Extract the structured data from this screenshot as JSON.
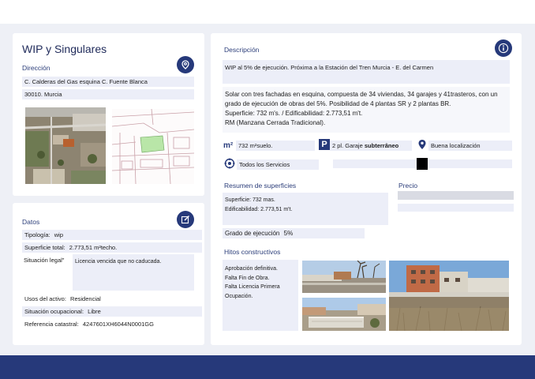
{
  "colors": {
    "accent": "#26397a",
    "panel_bg": "#ffffff",
    "field_bg": "#eceef8",
    "page_bg": "#eef0f6"
  },
  "header": {
    "title": "WIP y Singulares"
  },
  "direccion": {
    "label": "Dirección",
    "icon": "location-pin-icon",
    "line1": "C. Calderas del Gas esquina C. Fuente Blanca",
    "line2": "30010. Murcia"
  },
  "datos": {
    "label": "Datos",
    "icon": "edit-icon",
    "tipologia_label": "Tipología:",
    "tipologia_value": "wip",
    "superficie_label": "Superficie total:",
    "superficie_value": "2.773,51 m²techo.",
    "situacion_label": "Situación legal\"",
    "situacion_value": "Licencia vencida que no caducada.",
    "usos_label": "Usos del activo:",
    "usos_value": "Residencial",
    "ocupacional_label": "Situación ocupacional:",
    "ocupacional_value": "Libre",
    "catastral_label": "Referencia catastral:",
    "catastral_value": "4247601XH6044N0001GG"
  },
  "descripcion": {
    "label": "Descripción",
    "icon": "info-icon",
    "short": "WIP al 5% de ejecución. Próxima a la Estación del Tren Murcia - E. del Carmen",
    "long1": "Solar con tres fachadas en esquina, compuesta de 34 viviendas, 34 garajes y 41trasteros, con un grado de ejecución de obras del 5%. Posibilidad de 4 plantas SR y 2 plantas BR.",
    "long2": "Superficie: 732 m's. / Edificabilidad: 2.773,51 m't.",
    "long3": "RM (Manzana Cerrada Tradicional)."
  },
  "features": {
    "m2_symbol": "m²",
    "m2_text": "732  m²suelo.",
    "parking_symbol": "P",
    "parking_text": "2 pl.  Garaje",
    "parking_bold": "subterrâneo",
    "location_text": "Buena localización",
    "services_text": "Todos los Servicios"
  },
  "resumen": {
    "label": "Resumen de superficies",
    "line1": "Superficie: 732 mas.",
    "line2": "Edificabilidad: 2.773,51 m't."
  },
  "precio": {
    "label": "Precio"
  },
  "grado": {
    "label": "Grado de ejecución",
    "value": "5%"
  },
  "hitos": {
    "label": "Hitos constructivos",
    "line1": "Aprobación definitiva.",
    "line2": "Falta Fin de Obra.",
    "line3": "Falta Licencia Primera",
    "line4": "Ocupación."
  }
}
